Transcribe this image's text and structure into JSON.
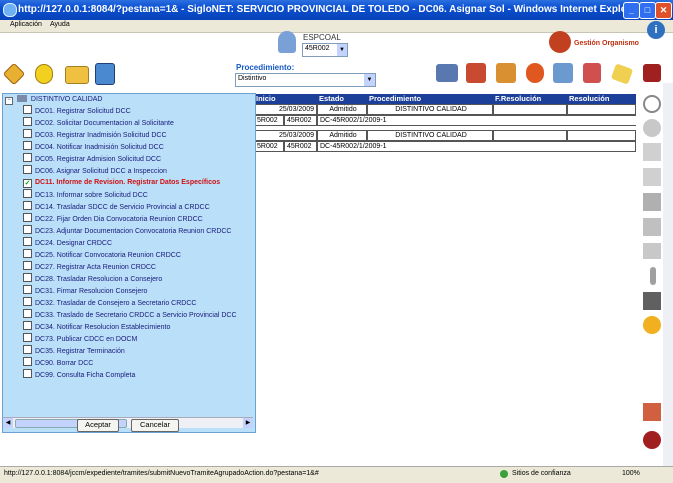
{
  "window": {
    "title": "http://127.0.0.1:8084/?pestana=1& - SigloNET: SERVICIO PROVINCIAL DE TOLEDO - DC06. Asignar Sol - Windows Internet Explorer",
    "min_glyph": "_",
    "max_glyph": "□",
    "close_glyph": "✕"
  },
  "menu": {
    "items": [
      "Aplicación",
      "Ayuda"
    ]
  },
  "header": {
    "espcoal_label": "ESPCOAL",
    "espcoal_value": "45R002",
    "gestion_label": "Gestión Organismo",
    "procedimiento_label": "Procedimiento:",
    "procedimiento_value": "Distintivo"
  },
  "table": {
    "columns": [
      "Inicio",
      "Estado",
      "Procedimiento",
      "F.Resolución",
      "Resolución"
    ],
    "rows": [
      {
        "inicio": "25/03/2009",
        "estado": "Admitido",
        "procedimiento": "DISTINTIVO CALIDAD"
      },
      {
        "col1": "5R002",
        "col2": "45R002",
        "col3": "DC-45R002/1/2009-1"
      },
      {
        "inicio": "25/03/2009",
        "estado": "Admitido",
        "procedimiento": "DISTINTIVO CALIDAD"
      },
      {
        "col1": "5R002",
        "col2": "45R002",
        "col3": "DC-45R002/1/2009-1"
      }
    ]
  },
  "tree": {
    "root": "DISTINTIVO CALIDAD",
    "items": [
      "DC01. Registrar Solicitud DCC",
      "DC02. Solicitar Documentacion al Solicitante",
      "DC03. Registrar Inadmisión Solicitud DCC",
      "DC04. Notificar Inadmisión Solicitud DCC",
      "DC05. Registrar Admision Solicitud DCC",
      "DC06. Asignar Solicitud DCC a Inspeccion",
      "DC11. Informe de Revision. Registrar Datos Específicos",
      "DC13. Informar sobre Solicitud DCC",
      "DC14. Trasladar SDCC de Servicio Provincial a CRDCC",
      "DC22. Fijar Orden Dia Convocatoria Reunion CRDCC",
      "DC23. Adjuntar Documentacion Convocatoria Reunion CRDCC",
      "DC24. Designar CRDCC",
      "DC25. Notificar Convocatoria Reunion CRDCC",
      "DC27. Registrar Acta Reunion CRDCC",
      "DC28. Trasladar Resolucion a Consejero",
      "DC31. Firmar Resolucion Consejero",
      "DC32. Trasladar de Consejero a Secretario CRDCC",
      "DC33. Traslado de Secretario CRDCC a Servicio Provincial DCC",
      "DC34. Notificar Resolucion Establecimiento",
      "DC73. Publicar CDCC en DOCM",
      "DC35. Registrar Terminación",
      "DC90. Borrar DCC",
      "DC99. Consulta Ficha Completa"
    ],
    "selected_index": 6,
    "checkmark": "✓",
    "accept_label": "Aceptar",
    "cancel_label": "Cancelar"
  },
  "status": {
    "url": "http://127.0.0.1:8084/jccm/expediente/tramites/submitNuevoTramiteAgrupadoAction.do?pestana=1&#",
    "trust": "Sitios de confianza",
    "zoom": "100%"
  }
}
